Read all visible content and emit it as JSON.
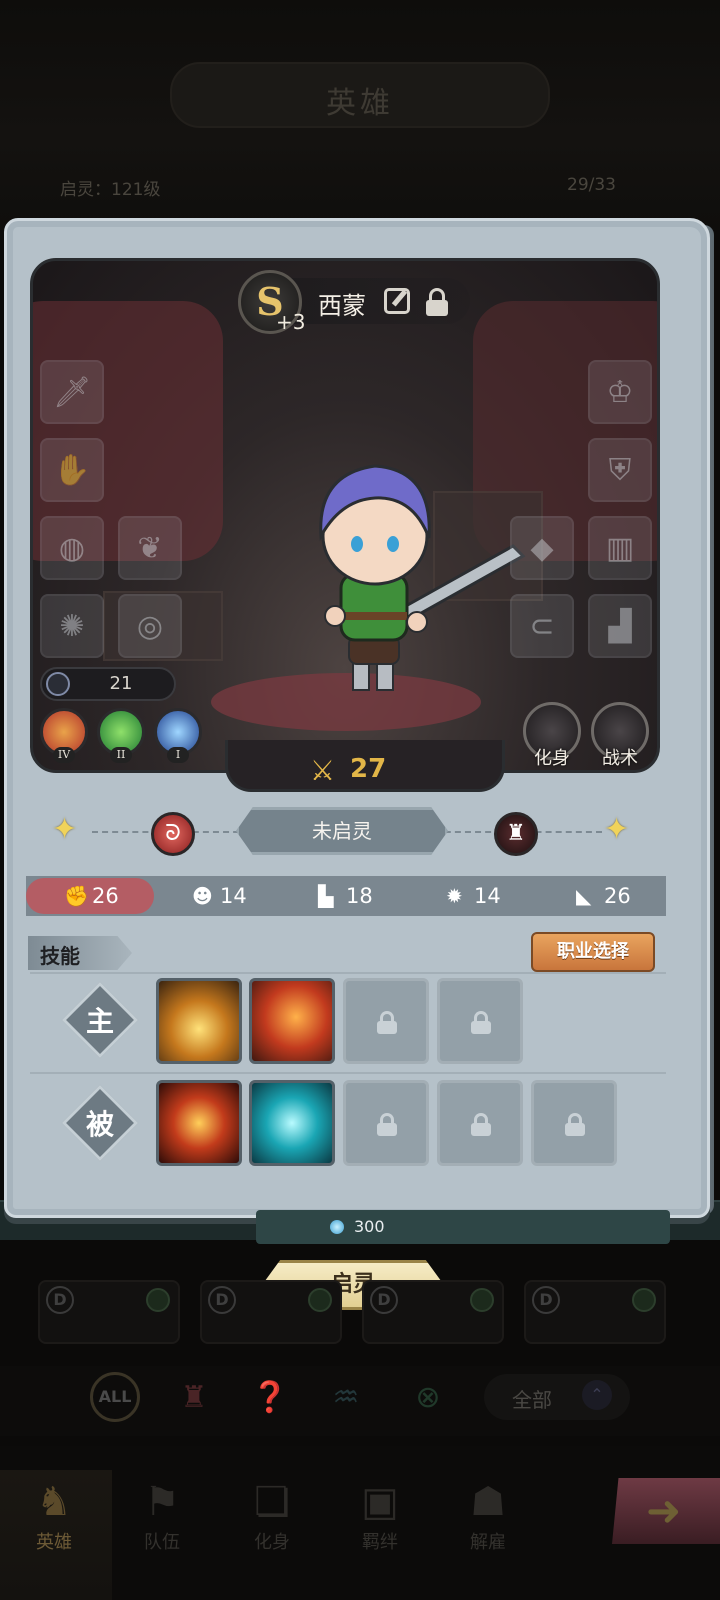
{
  "header": {
    "title": "英雄",
    "awaken_level": "启灵：121级",
    "hero_count": "29/33"
  },
  "hero": {
    "grade": "S",
    "grade_plus": "+3",
    "name": "西蒙",
    "power": "21",
    "attack": "27",
    "element_levels": [
      "IV",
      "II",
      "I"
    ],
    "buttons": {
      "incarnation": "化身",
      "tactics": "战术"
    }
  },
  "awakening": {
    "status": "未启灵"
  },
  "stats": [
    "26",
    "14",
    "18",
    "14",
    "26"
  ],
  "skills": {
    "title": "技能",
    "career_button": "职业选择",
    "active_label": "主",
    "passive_label": "被"
  },
  "cost": {
    "value": "300"
  },
  "awaken_button": "启灵",
  "filter": {
    "all": "ALL",
    "sort": "全部"
  },
  "nav": {
    "items": [
      "英雄",
      "队伍",
      "化身",
      "羁绊",
      "解雇"
    ]
  },
  "colors": {
    "accent_gold": "#e2b648",
    "stat_active": "#b45d64",
    "career_button": "#e09a55"
  }
}
